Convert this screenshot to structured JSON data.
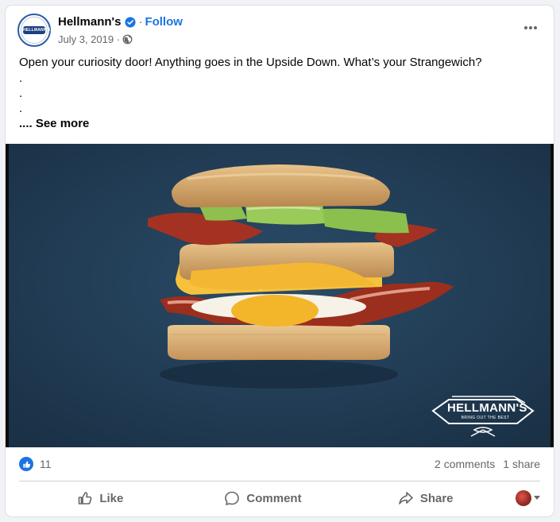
{
  "post": {
    "page_name": "Hellmann's",
    "follow_label": "Follow",
    "separator": "·",
    "date": "July 3, 2019 ·",
    "text": "Open your curiosity door! Anything goes in the Upside Down. What’s your Strangewich?",
    "dots": [
      ".",
      ".",
      "."
    ],
    "see_more": ".... See more"
  },
  "avatar": {
    "logo_text": "HELLMANN'S"
  },
  "media": {
    "logo_text": "HELLMANN'S",
    "logo_tagline": "BRING OUT THE BEST"
  },
  "stats": {
    "reactions_count": "11",
    "comments": "2 comments",
    "shares": "1 share"
  },
  "actions": {
    "like": "Like",
    "comment": "Comment",
    "share": "Share"
  },
  "colors": {
    "brand_blue": "#1b74e4",
    "media_bg": "#1f3a52",
    "text_secondary": "#65676b"
  },
  "icons": {
    "verified": "verified-badge-icon",
    "audience": "globe-icon",
    "more": "more-options-icon",
    "like_reaction": "thumbs-up-icon",
    "like_action": "thumbs-up-outline-icon",
    "comment_action": "speech-bubble-icon",
    "share_action": "share-arrow-icon",
    "viewer": "caret-down-icon"
  }
}
